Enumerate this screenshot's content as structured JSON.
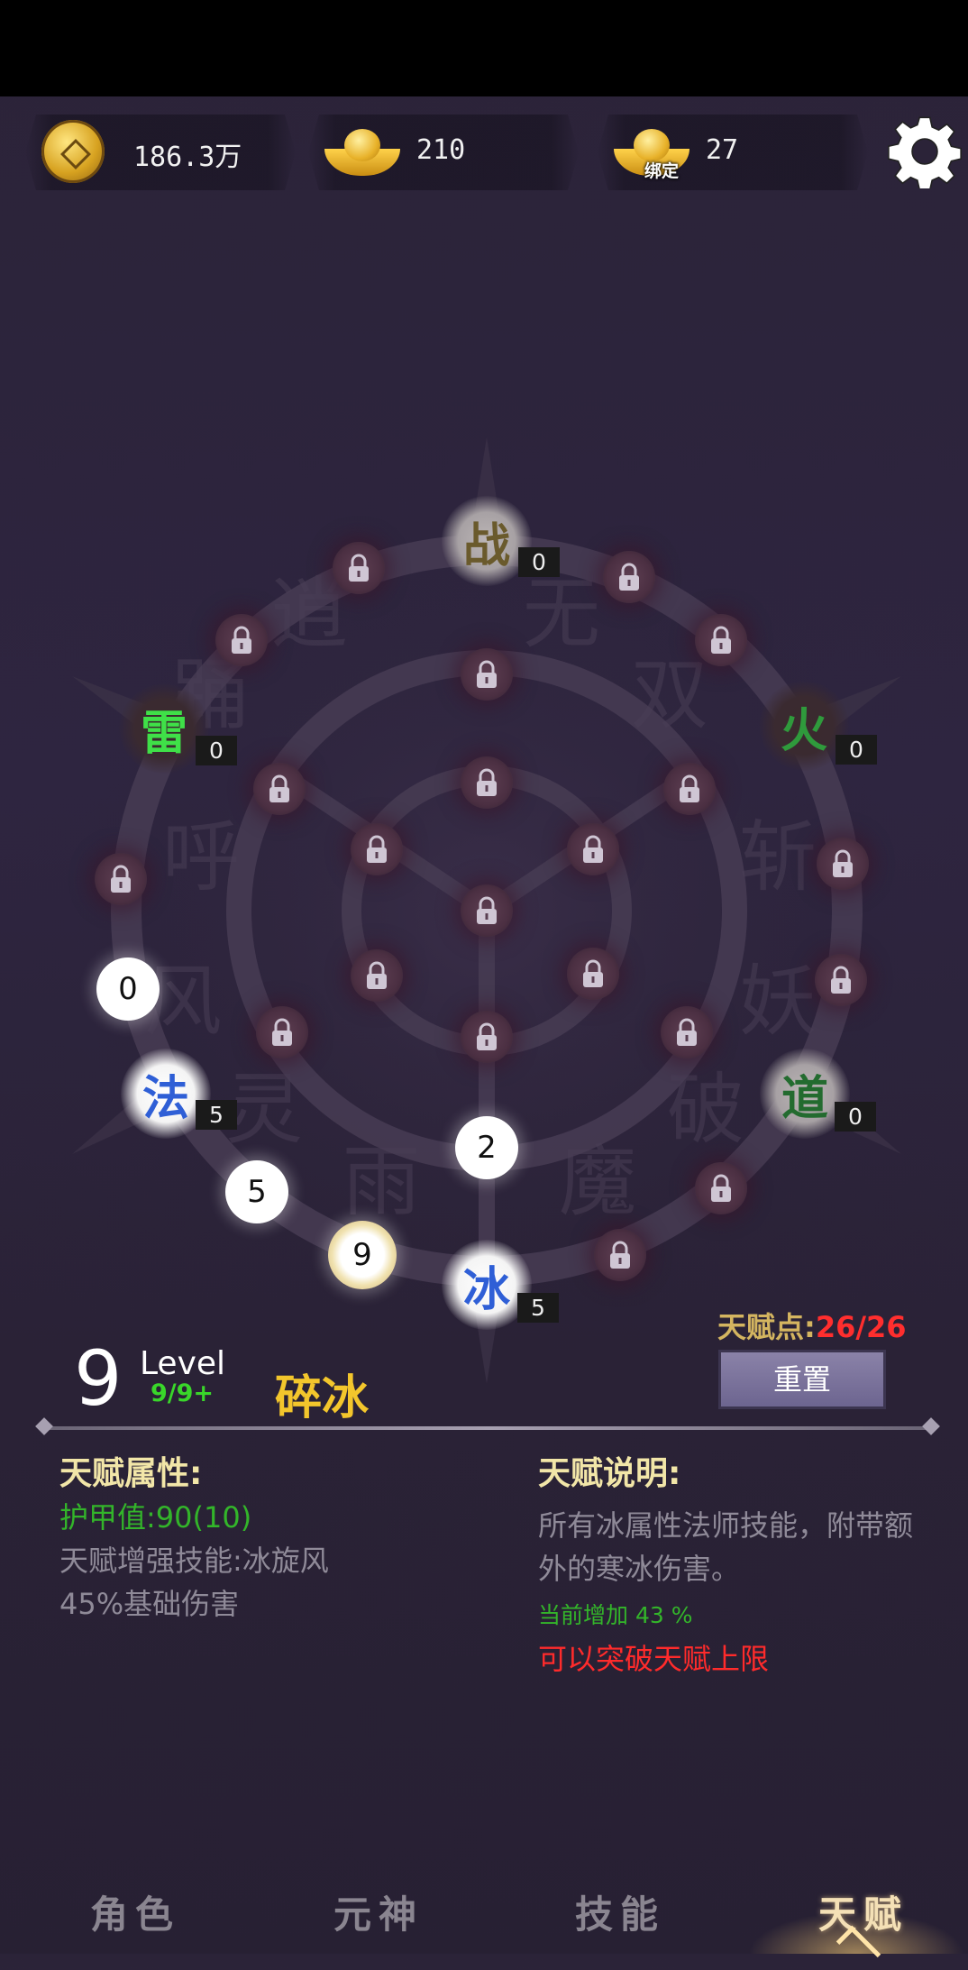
{
  "resources": {
    "coins": "186.3万",
    "gold": "210",
    "bound_gold": "27",
    "bound_tag": "绑定"
  },
  "elements": {
    "zhan": {
      "char": "战",
      "count": "0",
      "color": "#6a5a2c"
    },
    "lei": {
      "char": "雷",
      "count": "0",
      "color": "#3fe048"
    },
    "huo": {
      "char": "火",
      "count": "0",
      "color": "#2f9a3c"
    },
    "fa": {
      "char": "法",
      "count": "5",
      "color": "#2f5fd6"
    },
    "dao": {
      "char": "道",
      "count": "0",
      "color": "#236b2f"
    },
    "bing": {
      "char": "冰",
      "count": "5",
      "color": "#2f5fd6"
    }
  },
  "path_bubbles": [
    "0",
    "5",
    "9",
    "2"
  ],
  "talent_points": {
    "label": "天赋点:",
    "value": "26/26"
  },
  "reset_label": "重置",
  "level": {
    "number": "9",
    "word": "Level",
    "sub": "9/9+"
  },
  "skill_name": "碎冰",
  "attributes": {
    "title": "天赋属性:",
    "armor": "护甲值:90(10)",
    "enhance": "天赋增强技能:冰旋风",
    "damage": "45%基础伤害"
  },
  "description": {
    "title": "天赋说明:",
    "line1": "所有冰属性法师技能，附带额",
    "line2": "外的寒冰伤害。",
    "current": "当前增加 43 %",
    "breakthrough": "可以突破天赋上限"
  },
  "nav": [
    "角色",
    "元神",
    "技能",
    "天赋"
  ],
  "nav_active": 3
}
